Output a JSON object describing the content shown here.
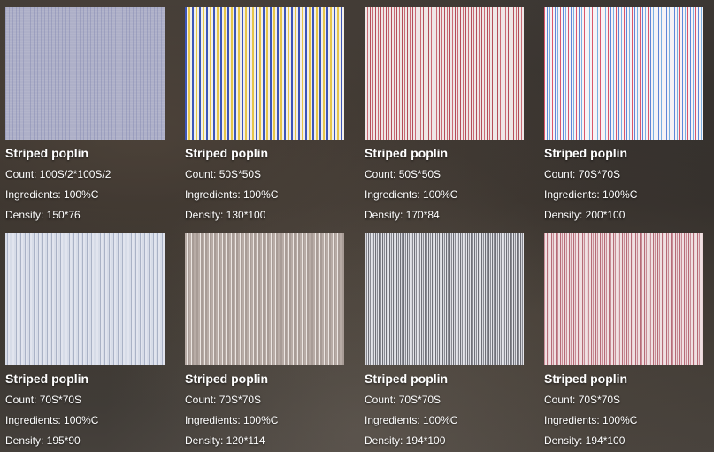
{
  "products": [
    {
      "title": "Striped poplin",
      "count": "Count: 100S/2*100S/2",
      "ingredients": "Ingredients: 100%C",
      "density": "Density: 150*76",
      "swatch_colors": [
        "#aeb0c8",
        "#787daa"
      ]
    },
    {
      "title": "Striped poplin",
      "count": "Count: 50S*50S",
      "ingredients": "Ingredients: 100%C",
      "density": "Density: 130*100",
      "swatch_colors": [
        "#3d55b8",
        "#f2efe8",
        "#e7c64a"
      ]
    },
    {
      "title": "Striped poplin",
      "count": "Count: 50S*50S",
      "ingredients": "Ingredients: 100%C",
      "density": "Density: 170*84",
      "swatch_colors": [
        "#b44d5a",
        "#efe6e6"
      ]
    },
    {
      "title": "Striped poplin",
      "count": "Count: 70S*70S",
      "ingredients": "Ingredients: 100%C",
      "density": "Density: 200*100",
      "swatch_colors": [
        "#d9566c",
        "#5f86d8",
        "#f6f3f6"
      ]
    },
    {
      "title": "Striped poplin",
      "count": "Count: 70S*70S",
      "ingredients": "Ingredients: 100%C",
      "density": "Density: 195*90",
      "swatch_colors": [
        "#d7dce8",
        "#aab2c6"
      ]
    },
    {
      "title": "Striped poplin",
      "count": "Count: 70S*70S",
      "ingredients": "Ingredients: 100%C",
      "density": "Density: 120*114",
      "swatch_colors": [
        "#b8aca6",
        "#ece6e2"
      ]
    },
    {
      "title": "Striped poplin",
      "count": "Count: 70S*70S",
      "ingredients": "Ingredients: 100%C",
      "density": "Density: 194*100",
      "swatch_colors": [
        "#6e6f77",
        "#d7d8de"
      ]
    },
    {
      "title": "Striped poplin",
      "count": "Count: 70S*70S",
      "ingredients": "Ingredients: 100%C",
      "density": "Density: 194*100",
      "swatch_colors": [
        "#c88d97",
        "#f0e0e2"
      ]
    }
  ]
}
